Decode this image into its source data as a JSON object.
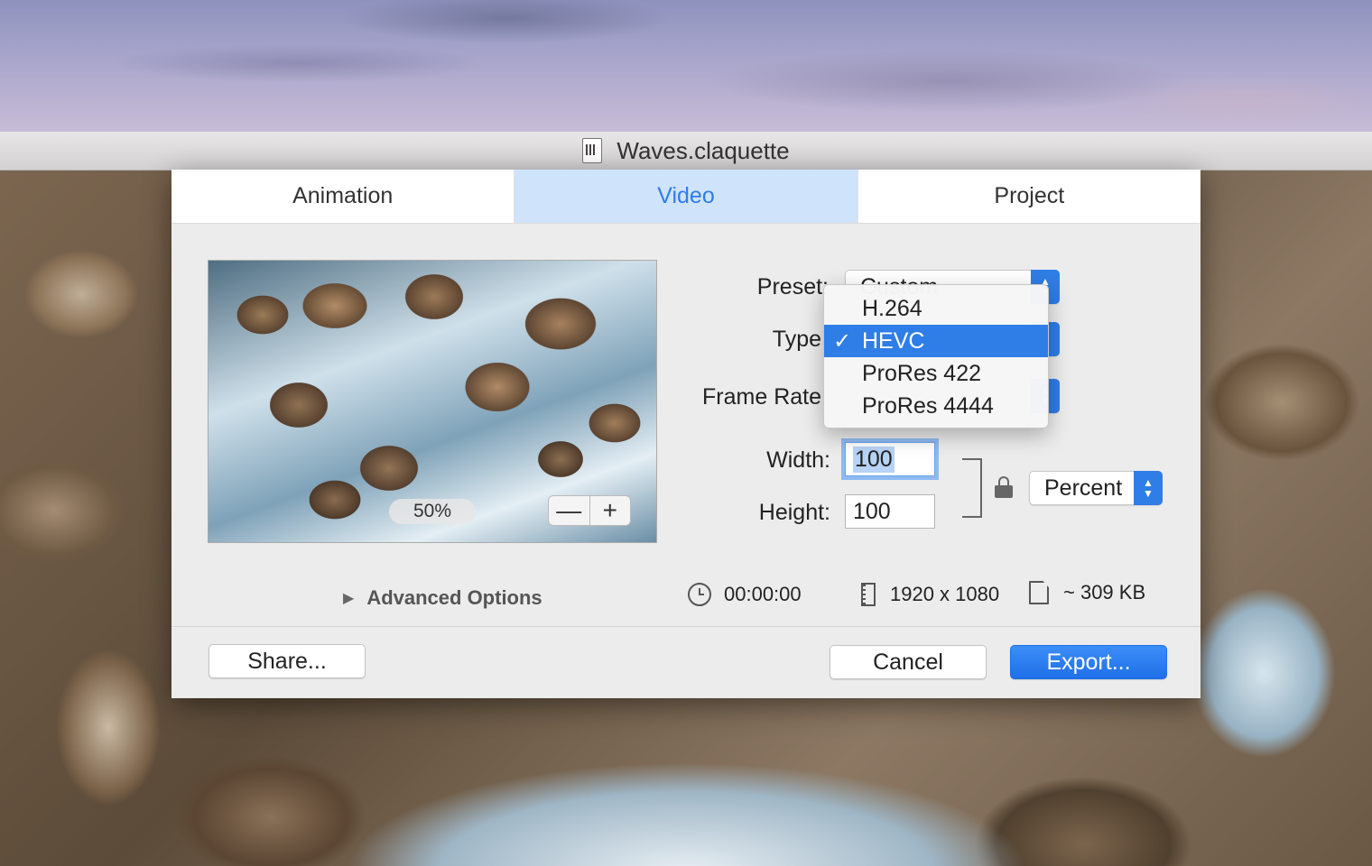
{
  "window": {
    "title": "Waves.claquette"
  },
  "tabs": [
    {
      "label": "Animation",
      "active": false
    },
    {
      "label": "Video",
      "active": true
    },
    {
      "label": "Project",
      "active": false
    }
  ],
  "preview": {
    "zoom_label": "50%",
    "zoom_out": "—",
    "zoom_in": "+"
  },
  "form": {
    "preset_label": "Preset:",
    "preset_value": "Custom",
    "type_label": "Type",
    "framerate_label": "Frame Rate",
    "width_label": "Width:",
    "width_value": "100",
    "height_label": "Height:",
    "height_value": "100",
    "unit_value": "Percent"
  },
  "type_menu": {
    "items": [
      "H.264",
      "HEVC",
      "ProRes 422",
      "ProRes 4444"
    ],
    "selected": "HEVC",
    "check": "✓"
  },
  "advanced_options_label": "Advanced Options",
  "info": {
    "duration": "00:00:00",
    "resolution": "1920 x 1080",
    "file_size": "~ 309 KB"
  },
  "buttons": {
    "share": "Share...",
    "cancel": "Cancel",
    "export": "Export..."
  },
  "colors": {
    "accent": "#2f7de6",
    "tab_active_bg": "#cfe3fa"
  }
}
